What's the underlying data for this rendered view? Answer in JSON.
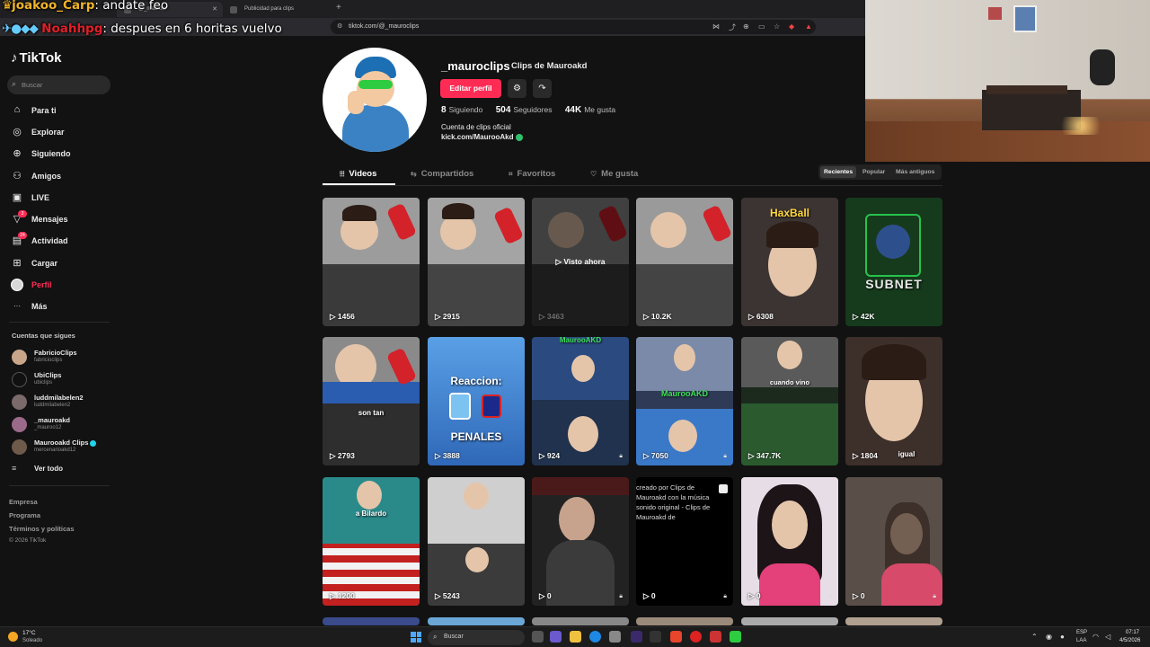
{
  "chat": [
    {
      "user": "joakoo_Carp",
      "message": "andate feo"
    },
    {
      "user": "Noahhpg",
      "message": "despues en 6 horitas vuelvo"
    }
  ],
  "browser": {
    "tabs": [
      {
        "title": "@_maurocl"
      },
      {
        "title": "Publicidad para clips"
      }
    ],
    "new_tab": "+",
    "url": "tiktok.com/@_mauroclips"
  },
  "sidebar": {
    "logo": "TikTok",
    "search_placeholder": "Buscar",
    "nav": [
      {
        "label": "Para ti",
        "icon": "home-icon",
        "glyph": "⌂"
      },
      {
        "label": "Explorar",
        "icon": "compass-icon",
        "glyph": "◎"
      },
      {
        "label": "Siguiendo",
        "icon": "following-icon",
        "glyph": "⊕"
      },
      {
        "label": "Amigos",
        "icon": "friends-icon",
        "glyph": "⚇"
      },
      {
        "label": "LIVE",
        "icon": "live-icon",
        "glyph": "▣"
      },
      {
        "label": "Mensajes",
        "icon": "messages-icon",
        "glyph": "▽",
        "badge": "3"
      },
      {
        "label": "Actividad",
        "icon": "activity-icon",
        "glyph": "▤",
        "badge": "24"
      },
      {
        "label": "Cargar",
        "icon": "upload-icon",
        "glyph": "⊞"
      },
      {
        "label": "Perfil",
        "icon": "profile-avatar-icon",
        "glyph": ""
      },
      {
        "label": "Más",
        "icon": "more-icon",
        "glyph": "···"
      }
    ],
    "following_title": "Cuentas que sigues",
    "following": [
      {
        "name": "FabricioClips",
        "handle": "fabricioclips"
      },
      {
        "name": "UbiClips",
        "handle": "ubiclips"
      },
      {
        "name": "luddmilabelen2",
        "handle": "luddmilabelen2"
      },
      {
        "name": "_mauroakd",
        "handle": "_mauroo12"
      },
      {
        "name": "Maurooakd Clips",
        "handle": "mercenarioakd12",
        "verified": true
      }
    ],
    "see_all": "Ver todo",
    "footer": [
      "Empresa",
      "Programa",
      "Términos y políticas"
    ],
    "copyright": "© 2026 TikTok"
  },
  "profile": {
    "username": "_mauroclips",
    "nickname": "Clips de Mauroakd",
    "edit_label": "Editar perfil",
    "stats": [
      {
        "value": "8",
        "label": "Siguiendo"
      },
      {
        "value": "504",
        "label": "Seguidores"
      },
      {
        "value": "44K",
        "label": "Me gusta"
      }
    ],
    "bio": "Cuenta de clips oficial",
    "link": "kick.com/MaurooAkd"
  },
  "tabs": [
    {
      "label": "Videos",
      "glyph": "⦙⦙⦙"
    },
    {
      "label": "Compartidos",
      "glyph": "⇆"
    },
    {
      "label": "Favoritos",
      "glyph": "⌗"
    },
    {
      "label": "Me gusta",
      "glyph": "♡"
    }
  ],
  "sort": [
    "Recientes",
    "Popular",
    "Más antiguos"
  ],
  "videos": [
    {
      "views": "1456"
    },
    {
      "views": "2915"
    },
    {
      "views": "3463",
      "watched_label": "Visto ahora"
    },
    {
      "views": "10.2K"
    },
    {
      "views": "6308",
      "caption": "HaxBall"
    },
    {
      "views": "42K",
      "caption": "SUBNET"
    },
    {
      "views": "2793",
      "caption": "son tan"
    },
    {
      "views": "3888",
      "caption": "Reaccion:",
      "caption2": "PENALES"
    },
    {
      "views": "924",
      "caption": "MaurooAKD"
    },
    {
      "views": "7050",
      "caption": "MaurooAKD"
    },
    {
      "views": "347.7K",
      "caption": "cuando vino"
    },
    {
      "views": "1804",
      "caption": "igual"
    },
    {
      "views": "1200",
      "caption": "a Bilardo"
    },
    {
      "views": "5243"
    },
    {
      "views": "0"
    },
    {
      "views": "0",
      "alt_text": "creado por Clips de Mauroakd con la música sonido original - Clips de Mauroakd de"
    },
    {
      "views": "0"
    },
    {
      "views": "0"
    }
  ],
  "taskbar": {
    "temp": "17°C",
    "weather": "Soleado",
    "search": "Buscar",
    "lang1": "ESP",
    "lang2": "LAA",
    "time": "07:17",
    "date": "4/5/2026"
  },
  "colors": {
    "accent": "#fe2c55",
    "background": "#121212"
  }
}
